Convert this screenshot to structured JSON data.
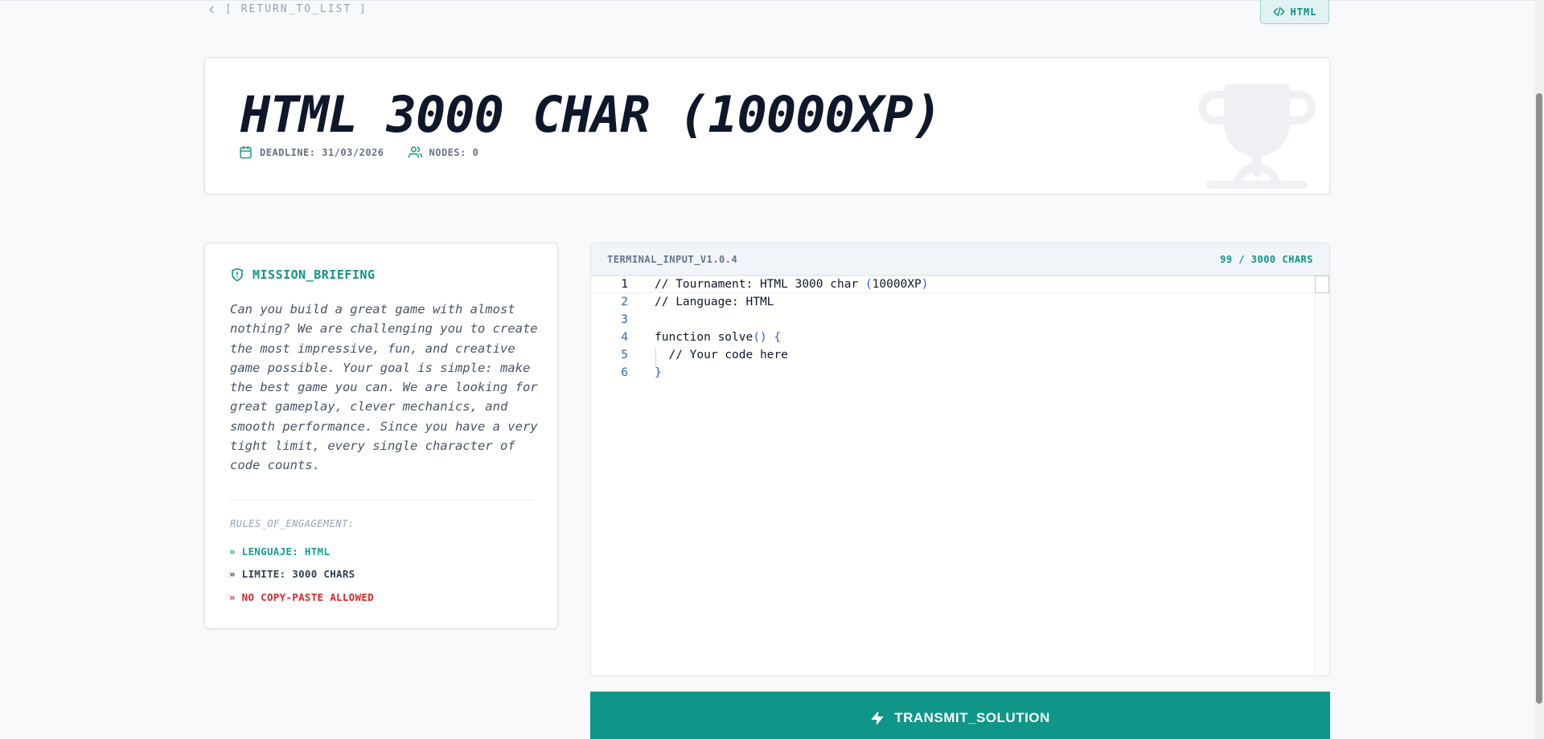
{
  "nav": {
    "back_label": "[ RETURN_TO_LIST ]",
    "language_badge": "HTML"
  },
  "tournament": {
    "title": "HTML 3000 CHAR (10000XP)",
    "deadline": "DEADLINE: 31/03/2026",
    "nodes": "NODES: 0"
  },
  "briefing": {
    "heading": "MISSION_BRIEFING",
    "text": "Can you build a great game with almost nothing? We are challenging you to create the most impressive, fun, and creative game possible. Your goal is simple: make the best game you can. We are looking for great gameplay, clever mechanics, and smooth performance. Since you have a very tight limit, every single character of code counts.",
    "rules_title": "RULES_OF_ENGAGEMENT:",
    "rules": [
      "» LENGUAJE: HTML",
      "» LIMITE: 3000 CHARS",
      "» NO COPY-PASTE ALLOWED"
    ]
  },
  "editor": {
    "name": "TERMINAL_INPUT_V1.0.4",
    "char_count": "99 / 3000 CHARS",
    "line_numbers": [
      "1",
      "2",
      "3",
      "4",
      "5",
      "6"
    ],
    "lines": [
      [
        "// Tournament: HTML 3000 char ",
        "(",
        "10000XP",
        ")"
      ],
      [
        "// Language: HTML"
      ],
      [
        ""
      ],
      [
        "function solve",
        "()",
        " ",
        "{"
      ],
      [
        "  // Your code here"
      ],
      [
        "}"
      ]
    ]
  },
  "actions": {
    "submit_label": "TRANSMIT_SOLUTION"
  },
  "colors": {
    "accent": "#0f9688",
    "danger": "#dc2626"
  },
  "icons": [
    "chevron-left-icon",
    "code-icon",
    "calendar-icon",
    "users-icon",
    "trophy-icon",
    "shield-icon",
    "lightning-icon"
  ]
}
